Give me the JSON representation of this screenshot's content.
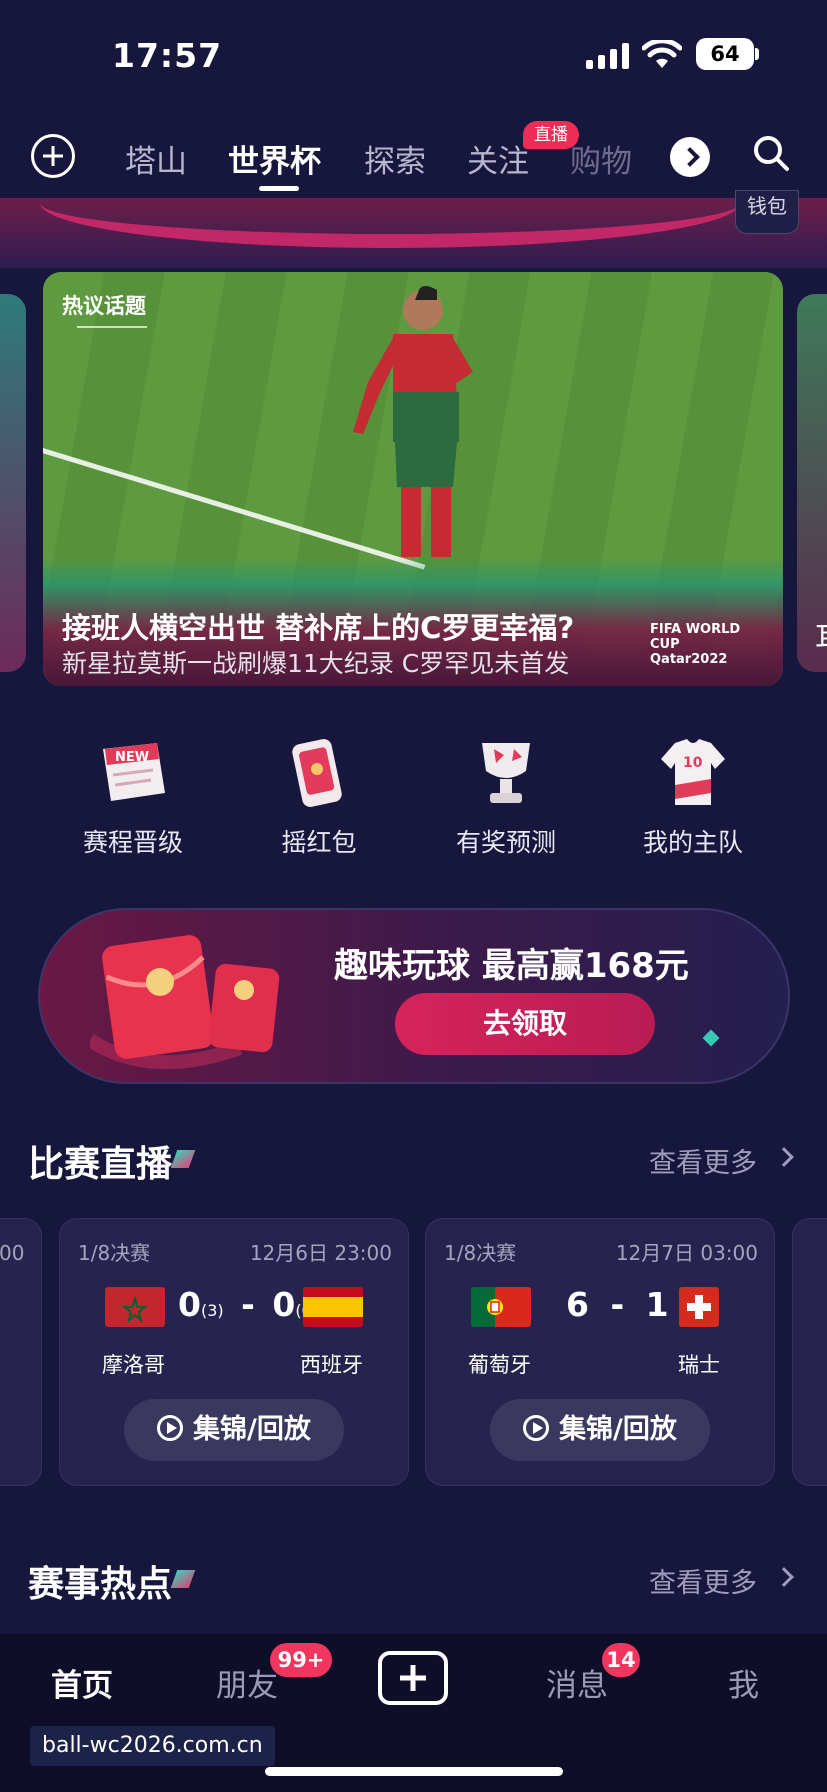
{
  "status_bar": {
    "time": "17:57",
    "battery": "64"
  },
  "top_nav": {
    "tabs": [
      {
        "label": "塔山",
        "active": false
      },
      {
        "label": "世界杯",
        "active": true
      },
      {
        "label": "探索",
        "active": false
      },
      {
        "label": "关注",
        "active": false
      },
      {
        "label": "购物",
        "active": false
      }
    ],
    "live_badge": "直播",
    "wallet": "钱包"
  },
  "hero": {
    "tag": "热议话题",
    "title": "接班人横空出世 替补席上的C罗更幸福?",
    "subtitle": "新星拉莫斯一战刷爆11大纪录 C罗罕见未首发",
    "logo_text": "FIFA WORLD CUP Qatar2022",
    "right_peek": "耳"
  },
  "quick_actions": [
    {
      "label": "赛程晋级",
      "icon": "new-schedule-icon"
    },
    {
      "label": "摇红包",
      "icon": "shake-red-envelope-icon"
    },
    {
      "label": "有奖预测",
      "icon": "trophy-icon"
    },
    {
      "label": "我的主队",
      "icon": "jersey-icon"
    }
  ],
  "promo": {
    "title": "趣味玩球 最高赢168元",
    "button": "去领取"
  },
  "live_section": {
    "title": "比赛直播",
    "more": "查看更多"
  },
  "matches": [
    {
      "stage": "1/8决赛",
      "time": "12月6日 23:00",
      "home": "摩洛哥",
      "away": "西班牙",
      "home_score": "0",
      "away_score": "0",
      "home_pen": "(3)",
      "away_pen": "(0)",
      "button": "集锦/回放"
    },
    {
      "stage": "1/8决赛",
      "time": "12月7日 03:00",
      "home": "葡萄牙",
      "away": "瑞士",
      "home_score": "6",
      "away_score": "1",
      "home_pen": "",
      "away_pen": "",
      "button": "集锦/回放"
    }
  ],
  "left_card_peek": "00",
  "hot_section": {
    "title": "赛事热点",
    "more": "查看更多"
  },
  "tab_bar": {
    "items": [
      {
        "label": "首页",
        "active": true
      },
      {
        "label": "朋友",
        "badge": "99+"
      },
      {
        "label": "消息",
        "badge": "14"
      },
      {
        "label": "我"
      }
    ]
  },
  "watermark": "ball-wc2026.com.cn",
  "colors": {
    "background": "#17163d",
    "accent": "#ee2c55",
    "teal": "#37d3b9"
  }
}
